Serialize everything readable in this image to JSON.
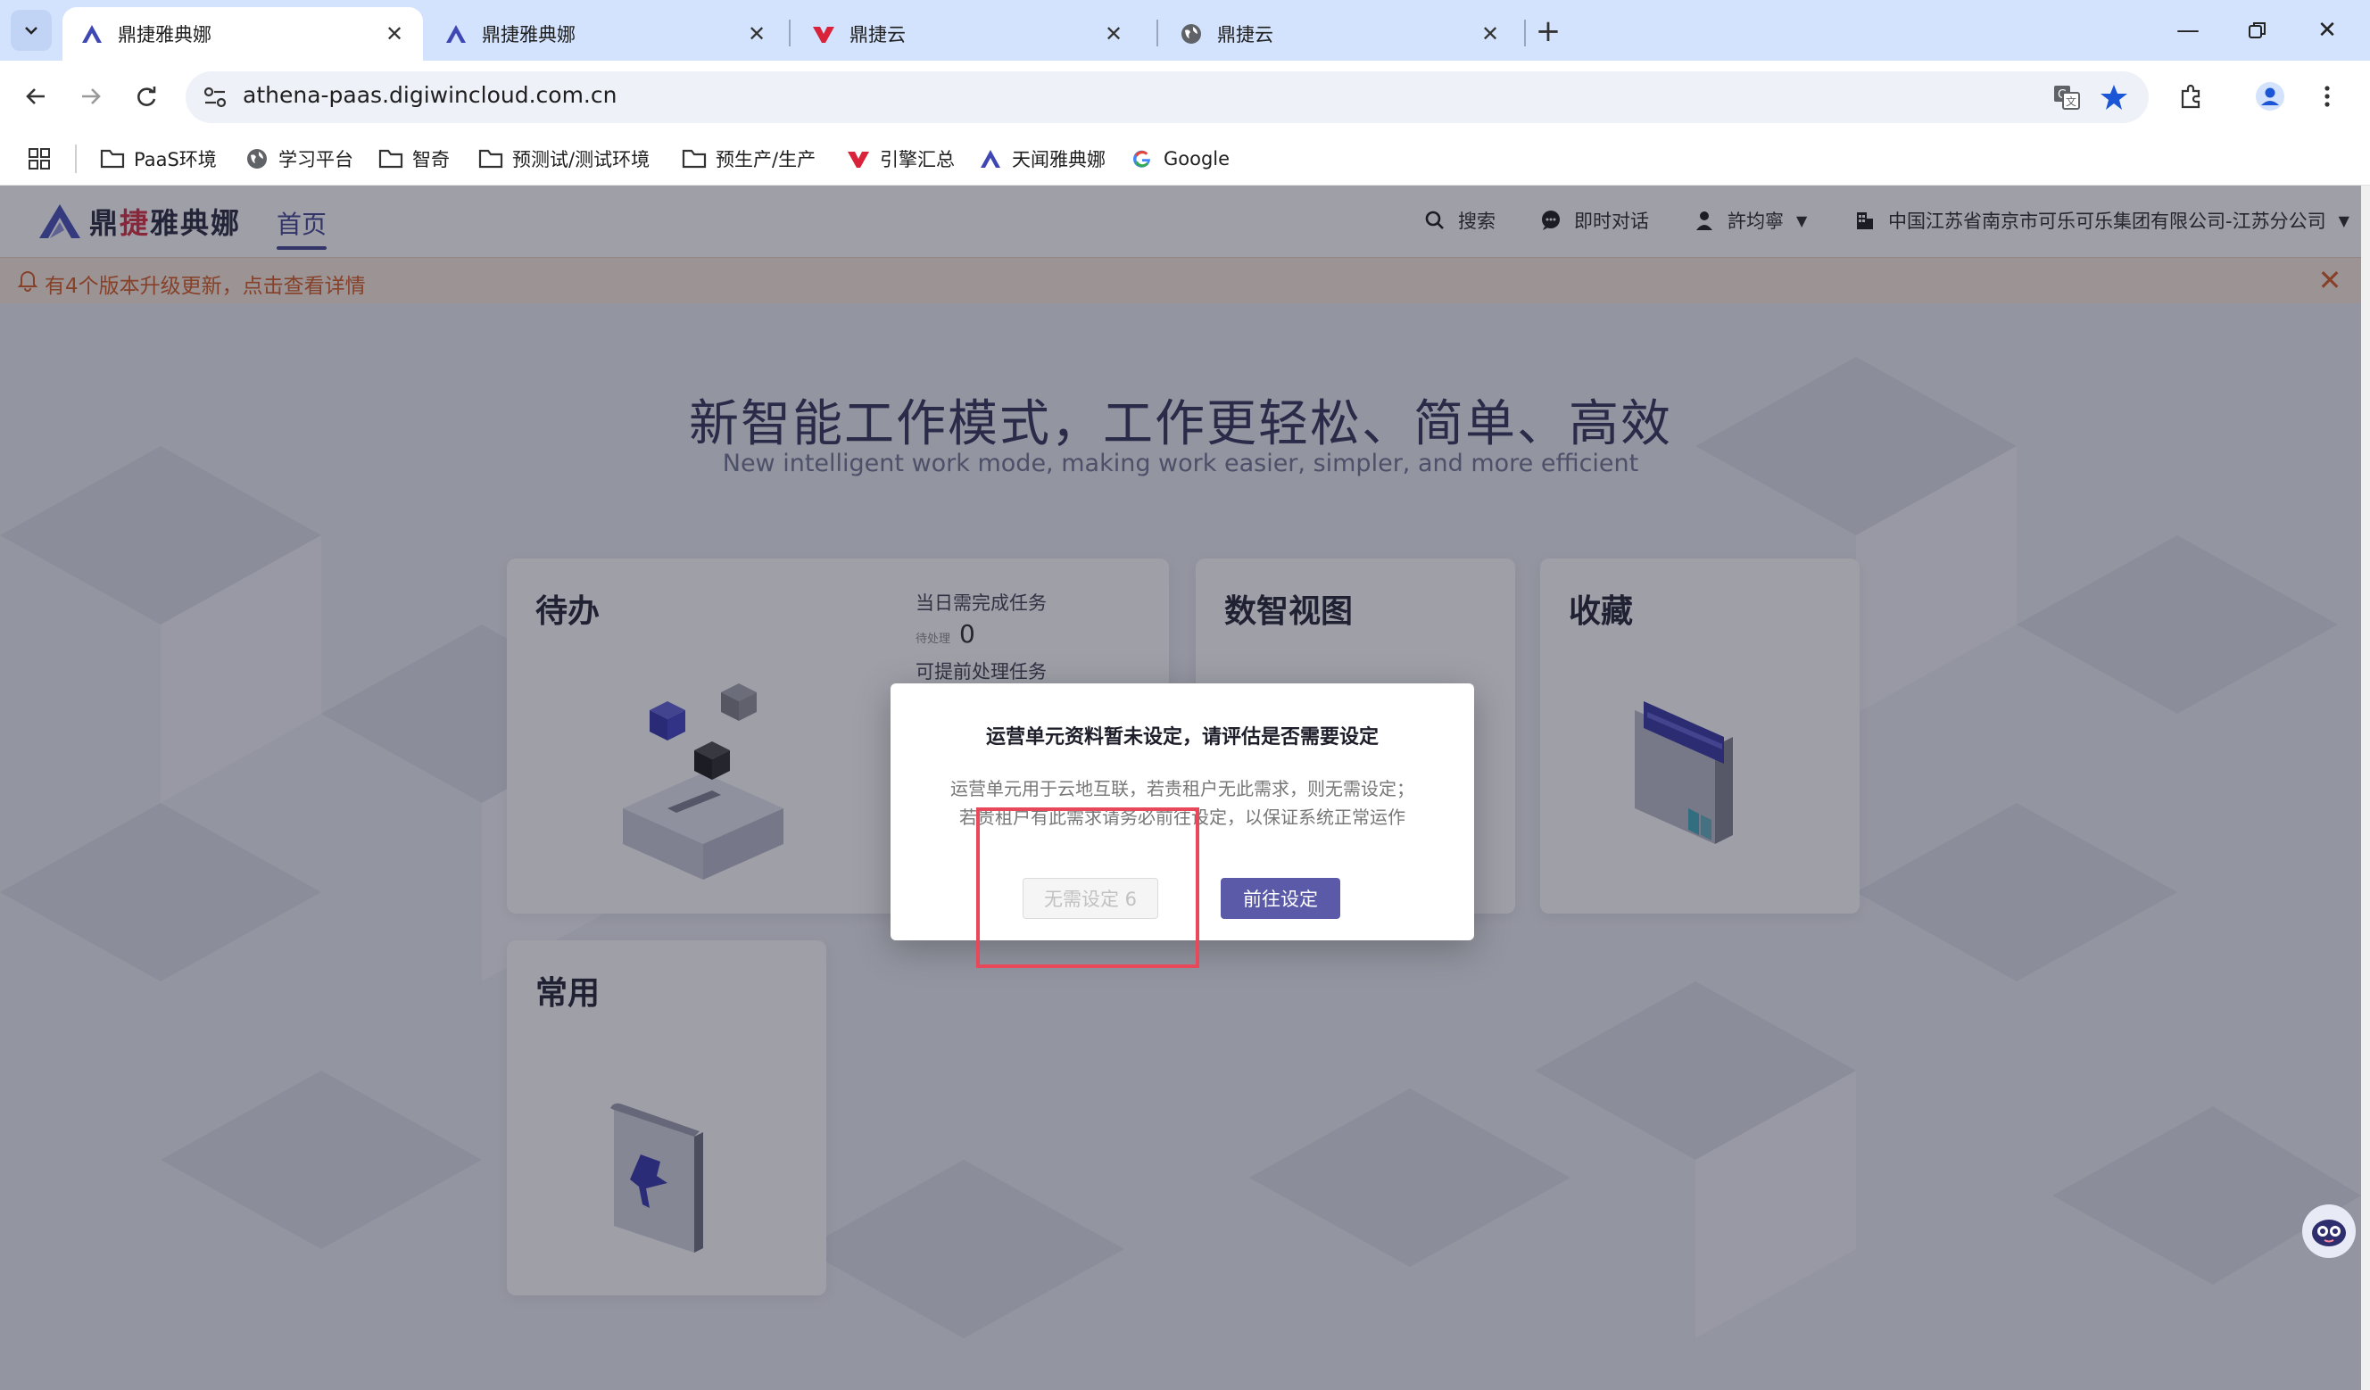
{
  "browser": {
    "tabs": [
      {
        "title": "鼎捷雅典娜",
        "favicon": "athena-logo-icon",
        "active": true
      },
      {
        "title": "鼎捷雅典娜",
        "favicon": "athena-logo-icon",
        "active": false
      },
      {
        "title": "鼎捷云",
        "favicon": "digiwin-cloud-icon",
        "active": false
      },
      {
        "title": "鼎捷云",
        "favicon": "globe-icon",
        "active": false
      }
    ],
    "url": "athena-paas.digiwincloud.com.cn",
    "bookmarks": [
      {
        "label": "PaaS环境",
        "icon": "folder-icon"
      },
      {
        "label": "学习平台",
        "icon": "globe-icon"
      },
      {
        "label": "智奇",
        "icon": "folder-icon"
      },
      {
        "label": "预测试/测试环境",
        "icon": "folder-icon"
      },
      {
        "label": "预生产/生产",
        "icon": "folder-icon"
      },
      {
        "label": "引擎汇总",
        "icon": "digiwin-cloud-icon"
      },
      {
        "label": "天闻雅典娜",
        "icon": "athena-logo-icon"
      },
      {
        "label": "Google",
        "icon": "google-icon"
      }
    ]
  },
  "app": {
    "logo_text_red": "捷",
    "logo_text_a": "鼎",
    "logo_text_b": "雅典娜",
    "nav_home": "首页",
    "header": {
      "search": "搜索",
      "chat": "即时对话",
      "user": "許均寧",
      "company": "中国江苏省南京市可乐可乐集团有限公司-江苏分公司"
    },
    "notice": "有4个版本升级更新，点击查看详情",
    "hero": {
      "title": "新智能工作模式，工作更轻松、简单、高效",
      "subtitle": "New intelligent work mode, making work easier, simpler, and more efficient"
    },
    "cards": {
      "todo": {
        "title": "待办",
        "stat1_label": "当日需完成任务",
        "stat1_sub": "待处理",
        "stat1_value": "0",
        "stat2_label": "可提前处理任务"
      },
      "dashboard": {
        "title": "数智视图"
      },
      "favorites": {
        "title": "收藏"
      },
      "common": {
        "title": "常用"
      }
    },
    "modal": {
      "title": "运营单元资料暂未设定，请评估是否需要设定",
      "line1": "运营单元用于云地互联，若贵租户无此需求，则无需设定；",
      "line2": "若贵租户有此需求请务必前往设定，以保证系统正常运作",
      "btn_skip": "无需设定 6",
      "btn_go": "前往设定"
    }
  },
  "colors": {
    "accent": "#5a5aa8",
    "notice_text": "#d4541a",
    "highlight": "#e8485a"
  }
}
